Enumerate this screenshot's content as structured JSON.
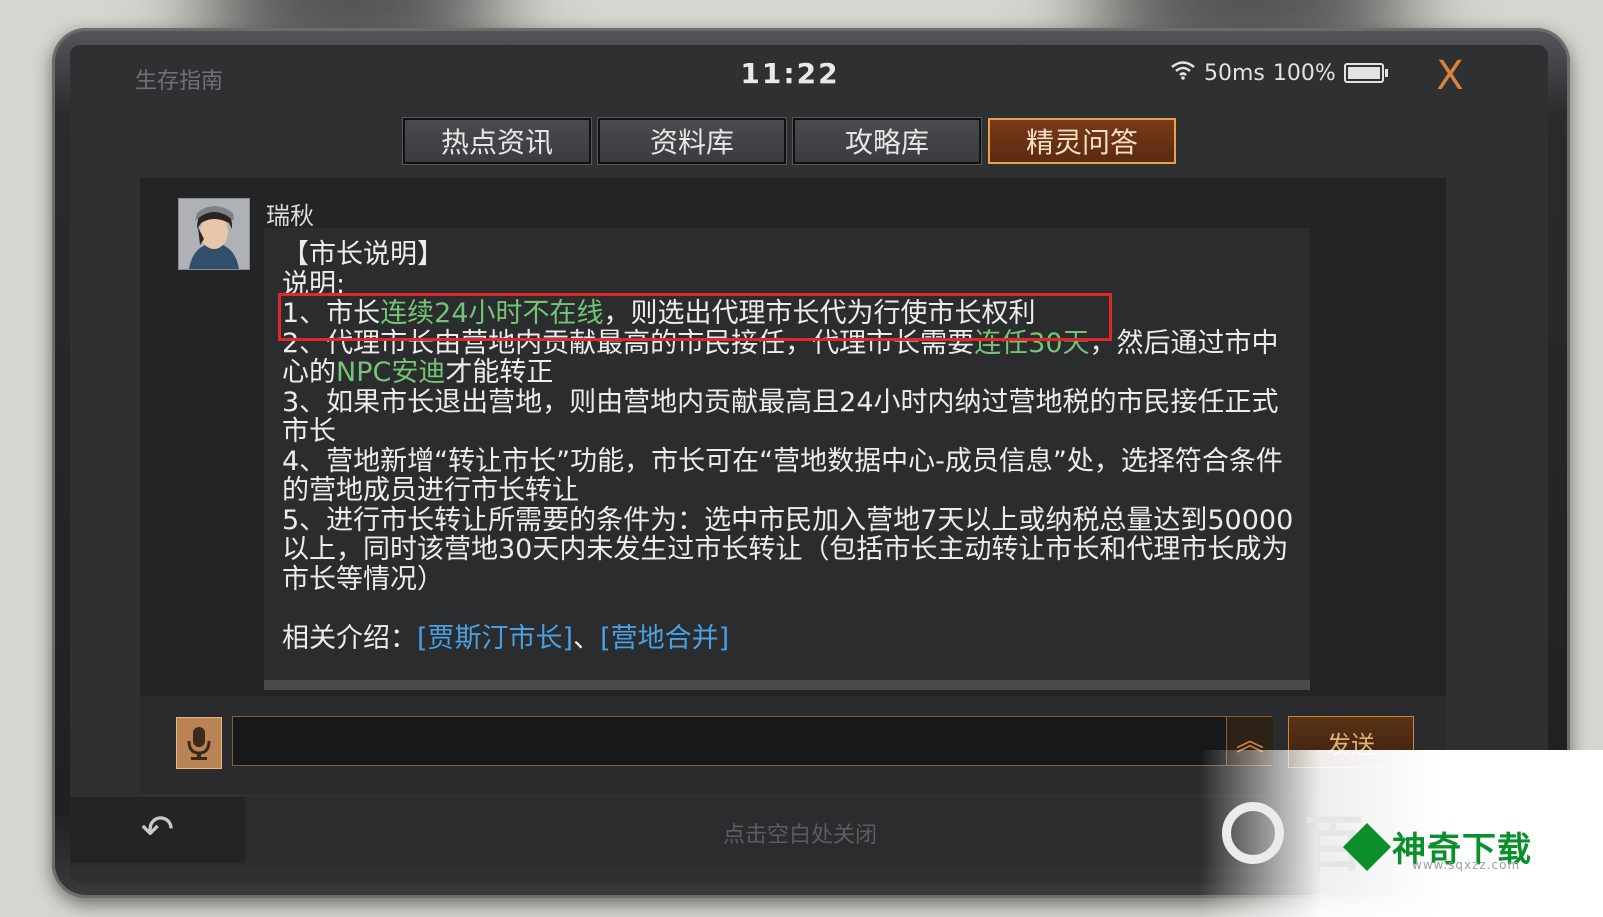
{
  "status_bar": {
    "app_title": "生存指南",
    "time": "11:22",
    "latency": "50ms",
    "battery": "100%",
    "close_label": "X"
  },
  "tabs": [
    {
      "label": "热点资讯",
      "active": false
    },
    {
      "label": "资料库",
      "active": false
    },
    {
      "label": "攻略库",
      "active": false
    },
    {
      "label": "精灵问答",
      "active": true
    }
  ],
  "chat": {
    "sender": "瑞秋",
    "message": {
      "title": "【市长说明】",
      "intro": "说明:",
      "rule1": {
        "pre": "1、市长",
        "green": "连续24小时不在线",
        "post": "，则选出代理市长代为行使市长权利"
      },
      "rule2": {
        "pre": "2、代理市长由营地内贡献最高的市民接任，代理市长需要",
        "green1": "连任30天",
        "mid": "，然后通过市中心的",
        "green2": "NPC安迪",
        "post": "才能转正"
      },
      "rule3": "3、如果市长退出营地，则由营地内贡献最高且24小时内纳过营地税的市民接任正式市长",
      "rule4": "4、营地新增“转让市长”功能，市长可在“营地数据中心-成员信息”处，选择符合条件的营地成员进行市长转让",
      "rule5": "5、进行市长转让所需要的条件为：选中市民加入营地7天以上或纳税总量达到50000以上，同时该营地30天内未发生过市长转让（包括市长主动转让市长和代理市长成为市长等情况）",
      "related_label": "相关介绍：",
      "link1": "[贾斯汀市长]",
      "sep": "、",
      "link2": "[营地合并]"
    }
  },
  "input": {
    "value": "",
    "send_label": "发送"
  },
  "bottom": {
    "back_icon": "undo-arrow",
    "close_hint": "点击空白处关闭"
  },
  "watermark": {
    "bai_char": "百",
    "brand": "神奇下载",
    "url": "www.sqxzz.com"
  },
  "colors": {
    "accent_orange": "#d9823a",
    "highlight_green": "#73c476",
    "link_blue": "#4aa0e0",
    "highlight_box": "#e02828"
  }
}
